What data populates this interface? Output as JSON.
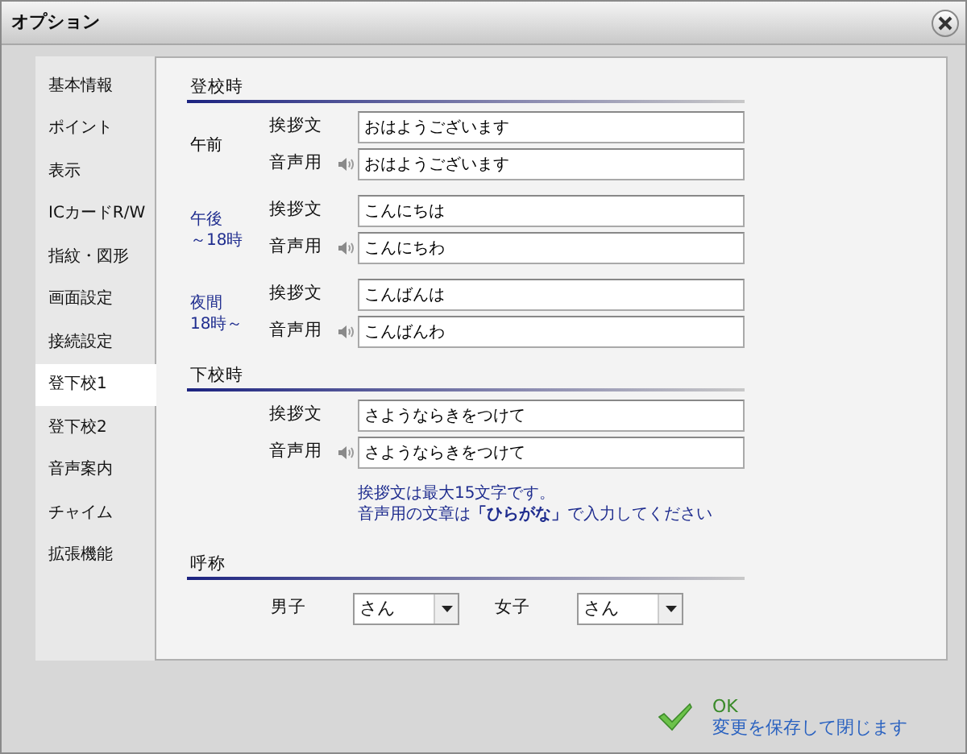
{
  "window": {
    "title": "オプション"
  },
  "sidebar": {
    "items": [
      {
        "label": "基本情報",
        "selected": false
      },
      {
        "label": "ポイント",
        "selected": false
      },
      {
        "label": "表示",
        "selected": false
      },
      {
        "label": "ICカードR/W",
        "selected": false
      },
      {
        "label": "指紋・図形",
        "selected": false
      },
      {
        "label": "画面設定",
        "selected": false
      },
      {
        "label": "接続設定",
        "selected": false
      },
      {
        "label": "登下校1",
        "selected": true
      },
      {
        "label": "登下校2",
        "selected": false
      },
      {
        "label": "音声案内",
        "selected": false
      },
      {
        "label": "チャイム",
        "selected": false
      },
      {
        "label": "拡張機能",
        "selected": false
      }
    ]
  },
  "sections": [
    {
      "heading": "登校時",
      "groups": [
        {
          "label": [
            "午前"
          ],
          "color": "#000000",
          "rows": [
            {
              "kind": "text",
              "label": "挨拶文",
              "value": "おはようございます"
            },
            {
              "kind": "voice",
              "label": "音声用",
              "value": "おはようございます"
            }
          ]
        },
        {
          "label": [
            "午後",
            "～18時"
          ],
          "color": "#1f2d8f",
          "rows": [
            {
              "kind": "text",
              "label": "挨拶文",
              "value": "こんにちは"
            },
            {
              "kind": "voice",
              "label": "音声用",
              "value": "こんにちわ"
            }
          ]
        },
        {
          "label": [
            "夜間",
            "18時～"
          ],
          "color": "#1f2d8f",
          "rows": [
            {
              "kind": "text",
              "label": "挨拶文",
              "value": "こんばんは"
            },
            {
              "kind": "voice",
              "label": "音声用",
              "value": "こんばんわ"
            }
          ]
        }
      ]
    },
    {
      "heading": "下校時",
      "groups": [
        {
          "rows": [
            {
              "kind": "text",
              "label": "挨拶文",
              "value": "さようならきをつけて"
            },
            {
              "kind": "voice",
              "label": "音声用",
              "value": "さようならきをつけて"
            }
          ]
        }
      ],
      "note": [
        "挨拶文は最大15文字です。",
        "音声用の文章は**「ひらがな」**で入力してください"
      ]
    },
    {
      "heading": "呼称",
      "selects": [
        {
          "label": "男子",
          "value": "さん"
        },
        {
          "label": "女子",
          "value": "さん"
        }
      ]
    }
  ],
  "footer": {
    "title": "OK",
    "description": "変更を保存して閉じます"
  }
}
